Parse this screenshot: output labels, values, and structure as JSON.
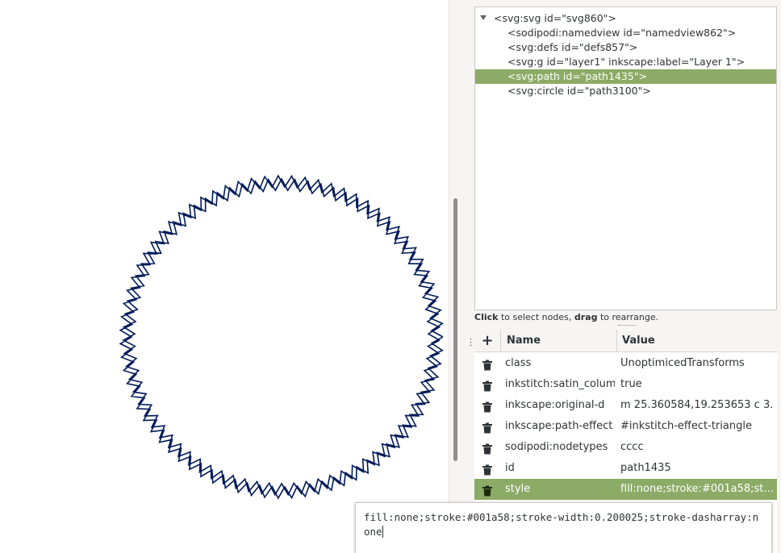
{
  "xml_tree": {
    "nodes": [
      {
        "text": "<svg:svg id=\"svg860\">",
        "level": 0,
        "expanded": true,
        "selected": false
      },
      {
        "text": "<sodipodi:namedview id=\"namedview862\">",
        "level": 1,
        "selected": false
      },
      {
        "text": "<svg:defs id=\"defs857\">",
        "level": 1,
        "selected": false
      },
      {
        "text": "<svg:g id=\"layer1\" inkscape:label=\"Layer 1\">",
        "level": 1,
        "selected": false
      },
      {
        "text": "<svg:path id=\"path1435\">",
        "level": 1,
        "selected": true
      },
      {
        "text": "<svg:circle id=\"path3100\">",
        "level": 1,
        "selected": false
      }
    ]
  },
  "hint": {
    "click": "Click",
    "part1": " to select nodes, ",
    "drag": "drag",
    "part2": " to rearrange."
  },
  "attributes": {
    "add_label": "+",
    "name_header": "Name",
    "value_header": "Value",
    "rows": [
      {
        "name": "class",
        "value": "UnoptimicedTransforms",
        "selected": false
      },
      {
        "name": "inkstitch:satin_column",
        "value": "true",
        "selected": false
      },
      {
        "name": "inkscape:original-d",
        "value": "m 25.360584,19.253653 c 3.",
        "selected": false
      },
      {
        "name": "inkscape:path-effect",
        "value": "#inkstitch-effect-triangle",
        "selected": false
      },
      {
        "name": "sodipodi:nodetypes",
        "value": "cccc",
        "selected": false
      },
      {
        "name": "id",
        "value": "path1435",
        "selected": false
      },
      {
        "name": "style",
        "value": "fill:none;stroke:#001a58;stroke-width:0.200025;stroke-dasharray:none",
        "selected": true
      }
    ]
  },
  "value_editor": {
    "text": "fill:none;stroke:#001a58;stroke-width:0.200025;stroke-dasharray:none"
  },
  "drawing": {
    "stroke_color": "#001a58"
  },
  "colors": {
    "selection": "#8cab66",
    "panel_bg": "#f6f5f4"
  }
}
